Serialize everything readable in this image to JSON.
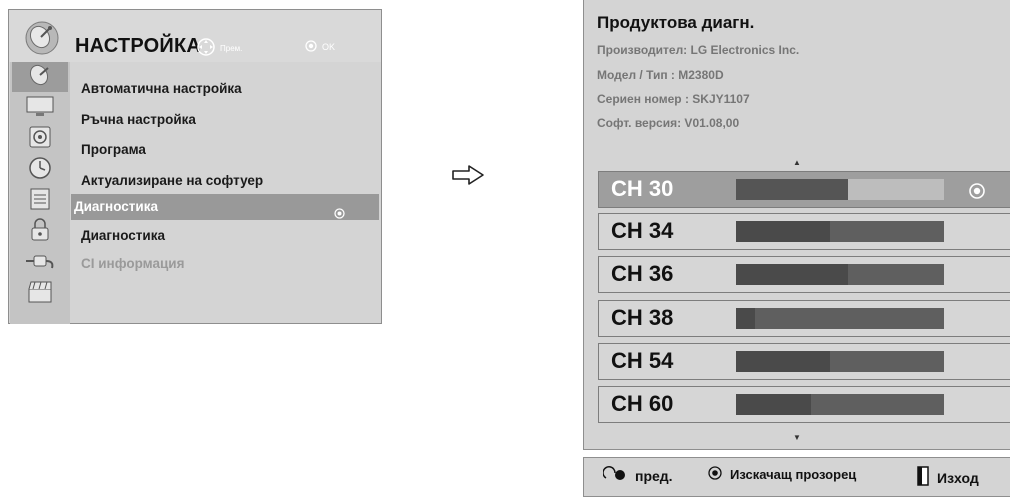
{
  "menu": {
    "title": "НАСТРОЙКА",
    "nav_hint": "Прем.",
    "ok_hint": "OK",
    "items": [
      {
        "label": "Автоматична настройка"
      },
      {
        "label": "Ръчна настройка"
      },
      {
        "label": "Програма"
      },
      {
        "label": "Актуализиране на софтуер"
      },
      {
        "label": "Диагностика"
      },
      {
        "label": "Диагностика"
      },
      {
        "label": "CI информация"
      }
    ],
    "side_icons": [
      "satellite-dish-icon",
      "monitor-icon",
      "speaker-icon",
      "clock-icon",
      "options-icon",
      "lock-icon",
      "input-plug-icon",
      "clapperboard-icon"
    ]
  },
  "diag": {
    "title": "Продуктова диагн.",
    "manufacturer": "Производител: LG Electronics Inc.",
    "model": "Модел / Тип : M2380D",
    "serial": "Сериен номер : SKJY1107",
    "software": "Софт. версия: V01.08,00",
    "up_arrow": "▲",
    "down_arrow": "▼",
    "channels": [
      {
        "label": "CH 30",
        "level": 0.54
      },
      {
        "label": "CH 34",
        "level": 0.45
      },
      {
        "label": "CH 36",
        "level": 0.54
      },
      {
        "label": "CH 38",
        "level": 0.09
      },
      {
        "label": "CH 54",
        "level": 0.45
      },
      {
        "label": "CH 60",
        "level": 0.36
      }
    ]
  },
  "footer": {
    "prev": "пред.",
    "popup": "Изскачащ прозорец",
    "exit": "Изход"
  },
  "colors": {
    "panel": "#d4d4d4",
    "selected": "#999999",
    "bar": "#5f5f5f",
    "bar_fill": "#4a4a4a"
  }
}
